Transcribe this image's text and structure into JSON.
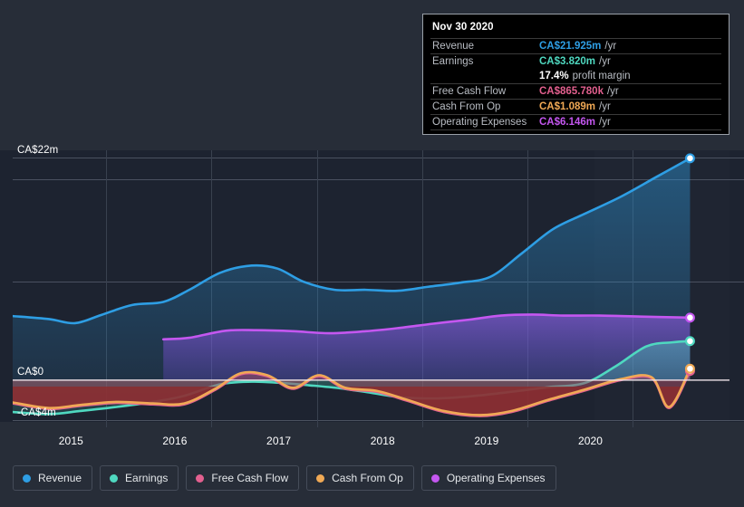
{
  "chart_data": {
    "type": "area",
    "title": "",
    "xlabel": "",
    "ylabel": "",
    "currency": "CA$",
    "ylim": [
      -4,
      24
    ],
    "y_ticks": [
      {
        "label": "CA$22m",
        "value": 22
      },
      {
        "label": "CA$0",
        "value": 0
      },
      {
        "label": "-CA$4m",
        "value": -4
      }
    ],
    "x_ticks": [
      "2015",
      "2016",
      "2017",
      "2018",
      "2019",
      "2020"
    ],
    "x_range": [
      "2014.4",
      "2021.3"
    ],
    "grid": true,
    "legend_position": "bottom-left",
    "forecast_divider_year": "2020.0",
    "zero_line": true,
    "series": [
      {
        "name": "Revenue",
        "color": "#2e9ee4",
        "fill": "#1d4a6e",
        "x": [
          2014.4,
          2014.75,
          2015.0,
          2015.25,
          2015.55,
          2015.85,
          2016.1,
          2016.4,
          2016.7,
          2016.95,
          2017.2,
          2017.5,
          2017.8,
          2018.1,
          2018.4,
          2018.7,
          2019.0,
          2019.3,
          2019.6,
          2019.9,
          2020.25,
          2020.6,
          2020.92
        ],
        "y": [
          6.3,
          6.0,
          5.6,
          6.4,
          7.4,
          7.7,
          8.9,
          10.6,
          11.3,
          11.0,
          9.7,
          8.9,
          8.9,
          8.8,
          9.2,
          9.6,
          10.2,
          12.5,
          14.9,
          16.4,
          18.1,
          20.1,
          21.925
        ]
      },
      {
        "name": "Earnings",
        "color": "#4fd8c0",
        "fill": "#2f7d86",
        "x": [
          2014.4,
          2014.75,
          2015.05,
          2015.4,
          2015.75,
          2016.05,
          2016.4,
          2016.7,
          2016.95,
          2017.25,
          2017.55,
          2017.85,
          2018.15,
          2018.5,
          2018.85,
          2019.2,
          2019.55,
          2019.9,
          2020.2,
          2020.5,
          2020.75,
          2020.92
        ],
        "y": [
          -3.2,
          -3.4,
          -3.1,
          -2.7,
          -2.2,
          -1.6,
          -0.45,
          -0.2,
          -0.3,
          -0.55,
          -0.85,
          -1.3,
          -1.75,
          -1.85,
          -1.6,
          -1.2,
          -0.75,
          -0.35,
          1.3,
          3.3,
          3.7,
          3.82
        ]
      },
      {
        "name": "Free Cash Flow",
        "color": "#e3608f",
        "fill": "#7a2430",
        "x": [
          2014.4,
          2014.75,
          2015.05,
          2015.4,
          2015.75,
          2016.05,
          2016.35,
          2016.6,
          2016.85,
          2017.1,
          2017.35,
          2017.6,
          2017.9,
          2018.2,
          2018.55,
          2018.9,
          2019.2,
          2019.55,
          2019.9,
          2020.25,
          2020.55,
          2020.72,
          2020.92
        ],
        "y": [
          -2.35,
          -2.9,
          -2.6,
          -2.3,
          -2.45,
          -2.45,
          -1.0,
          0.55,
          0.35,
          -0.9,
          0.35,
          -0.9,
          -1.2,
          -2.1,
          -3.2,
          -3.6,
          -3.2,
          -2.1,
          -1.1,
          -0.05,
          0.15,
          -2.8,
          0.866
        ]
      },
      {
        "name": "Cash From Op",
        "color": "#f0a955",
        "fill": "#8a5a2a",
        "x": [
          2014.4,
          2014.75,
          2015.05,
          2015.4,
          2015.75,
          2016.05,
          2016.35,
          2016.6,
          2016.85,
          2017.1,
          2017.35,
          2017.6,
          2017.9,
          2018.2,
          2018.55,
          2018.9,
          2019.2,
          2019.55,
          2019.9,
          2020.25,
          2020.55,
          2020.72,
          2020.92
        ],
        "y": [
          -2.25,
          -2.8,
          -2.5,
          -2.2,
          -2.35,
          -2.35,
          -0.9,
          0.65,
          0.45,
          -0.8,
          0.45,
          -0.8,
          -1.1,
          -2.0,
          -3.1,
          -3.5,
          -3.1,
          -2.0,
          -1.0,
          0.05,
          0.25,
          -2.7,
          1.089
        ]
      },
      {
        "name": "Operating Expenses",
        "color": "#c457f0",
        "fill": "#4a3f82",
        "x": [
          2015.85,
          2016.1,
          2016.45,
          2016.75,
          2017.1,
          2017.45,
          2017.8,
          2018.1,
          2018.45,
          2018.8,
          2019.1,
          2019.4,
          2019.7,
          2020.05,
          2020.45,
          2020.92
        ],
        "y": [
          4.0,
          4.15,
          4.85,
          4.9,
          4.8,
          4.6,
          4.8,
          5.1,
          5.55,
          5.95,
          6.35,
          6.45,
          6.35,
          6.35,
          6.25,
          6.146
        ]
      }
    ]
  },
  "tooltip": {
    "title": "Nov 30 2020",
    "rows": [
      {
        "label": "Revenue",
        "value": "CA$21.925m",
        "unit": "/yr",
        "color": "#2e9ee4"
      },
      {
        "label": "Earnings",
        "value": "CA$3.820m",
        "unit": "/yr",
        "color": "#4fd8c0"
      },
      {
        "label": "Free Cash Flow",
        "value": "CA$865.780k",
        "unit": "/yr",
        "color": "#e3608f"
      },
      {
        "label": "Cash From Op",
        "value": "CA$1.089m",
        "unit": "/yr",
        "color": "#f0a955"
      },
      {
        "label": "Operating Expenses",
        "value": "CA$6.146m",
        "unit": "/yr",
        "color": "#c457f0"
      }
    ],
    "profit_margin_value": "17.4%",
    "profit_margin_label": "profit margin"
  },
  "legend": {
    "items": [
      {
        "label": "Revenue",
        "color": "#2e9ee4"
      },
      {
        "label": "Earnings",
        "color": "#4fd8c0"
      },
      {
        "label": "Free Cash Flow",
        "color": "#e3608f"
      },
      {
        "label": "Cash From Op",
        "color": "#f0a955"
      },
      {
        "label": "Operating Expenses",
        "color": "#c457f0"
      }
    ]
  }
}
